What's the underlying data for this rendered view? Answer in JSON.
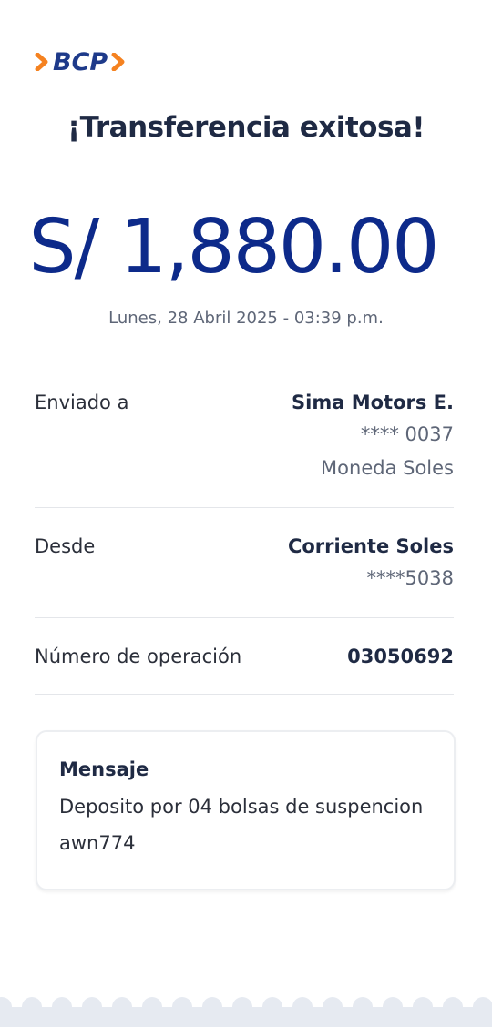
{
  "brand": {
    "name": "BCP",
    "colors": {
      "primary": "#0d2a8a",
      "accent": "#f58220"
    }
  },
  "header": {
    "title": "¡Transferencia exitosa!"
  },
  "transfer": {
    "amount": "S/ 1,880.00",
    "datetime": "Lunes, 28 Abril 2025 - 03:39 p.m."
  },
  "details": {
    "sent_to": {
      "label": "Enviado a",
      "name": "Sima Motors E.",
      "account": "**** 0037",
      "currency": "Moneda Soles"
    },
    "from": {
      "label": "Desde",
      "account_type": "Corriente Soles",
      "account": "****5038"
    },
    "operation": {
      "label": "Número de operación",
      "number": "03050692"
    }
  },
  "message": {
    "title": "Mensaje",
    "body": "Deposito por 04 bolsas de suspencion awn774"
  }
}
